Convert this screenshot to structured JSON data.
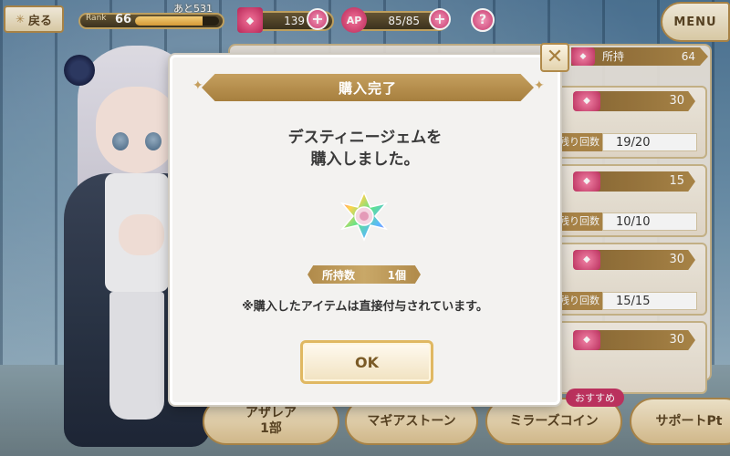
{
  "hud": {
    "back_label": "戻る",
    "back_icon": "sparkle-icon",
    "rank_label": "Rank",
    "rank_value": "66",
    "rank_remaining": "あと531",
    "rank_progress": 0.8,
    "gem_count": "139",
    "ap_label": "AP",
    "ap_value": "85/85",
    "help_label": "?",
    "menu_label": "MENU"
  },
  "shop": {
    "owned_label": "所持",
    "owned_value": "64",
    "items": [
      {
        "price": "30",
        "stock_label": "残り回数",
        "stock": "19/20"
      },
      {
        "price": "15",
        "stock_label": "残り回数",
        "stock": "10/10"
      },
      {
        "price": "30",
        "stock_label": "残り回数",
        "stock": "15/15"
      },
      {
        "price": "30"
      }
    ]
  },
  "tabs": [
    {
      "label": "アザレア\n1部"
    },
    {
      "label": "マギアストーン"
    },
    {
      "label": "ミラーズコイン",
      "badge": "おすすめ"
    },
    {
      "label": "サポートPt"
    }
  ],
  "modal": {
    "title": "購入完了",
    "message_line1": "デスティニージェムを",
    "message_line2": "購入しました。",
    "item_icon": "destiny-gem-icon",
    "owned_label": "所持数",
    "owned_value": "1個",
    "note": "※購入したアイテムは直接付与されています。",
    "ok_label": "OK",
    "close_icon": "close-icon"
  },
  "colors": {
    "gold": "#b08a4a",
    "header_gold": "#c59f5e",
    "pink_accent": "#c43463",
    "modal_bg": "#f3f2f0"
  }
}
